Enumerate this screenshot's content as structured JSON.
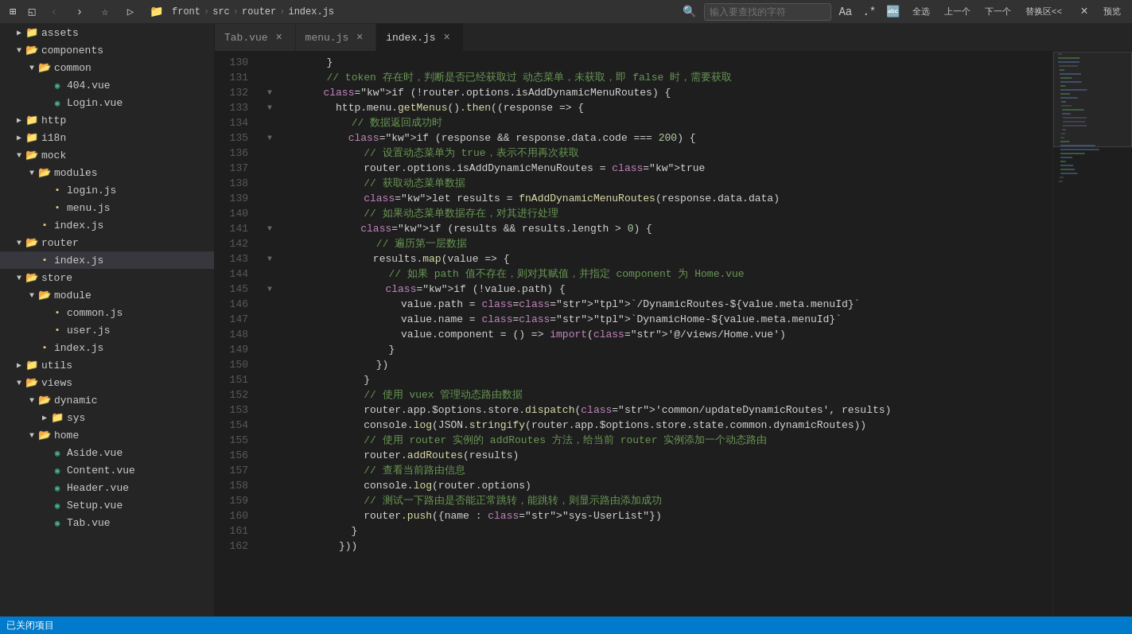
{
  "titlebar": {
    "icons": [
      "⊞",
      "◱"
    ],
    "nav_back": "‹",
    "nav_forward": "›",
    "nav_back_disabled": true,
    "nav_forward_disabled": false,
    "star_label": "☆",
    "play_label": "▷",
    "breadcrumb": [
      "front",
      "src",
      "router",
      "index.js"
    ],
    "search_placeholder": "输入要查找的字符",
    "btn_all": "全选",
    "btn_prev": "上一个",
    "btn_next": "下一个",
    "btn_replace": "替换区<<",
    "btn_close": "×",
    "btn_preview": "预览"
  },
  "tabs": [
    {
      "label": "Tab.vue",
      "active": false
    },
    {
      "label": "menu.js",
      "active": false
    },
    {
      "label": "index.js",
      "active": true
    }
  ],
  "sidebar": {
    "items": [
      {
        "type": "folder",
        "label": "assets",
        "depth": 1,
        "open": false
      },
      {
        "type": "folder",
        "label": "components",
        "depth": 1,
        "open": true
      },
      {
        "type": "folder",
        "label": "common",
        "depth": 2,
        "open": true
      },
      {
        "type": "file",
        "label": "404.vue",
        "depth": 3,
        "ext": "vue"
      },
      {
        "type": "file",
        "label": "Login.vue",
        "depth": 3,
        "ext": "vue"
      },
      {
        "type": "folder",
        "label": "http",
        "depth": 1,
        "open": false
      },
      {
        "type": "folder",
        "label": "i18n",
        "depth": 1,
        "open": false
      },
      {
        "type": "folder",
        "label": "mock",
        "depth": 1,
        "open": true
      },
      {
        "type": "folder",
        "label": "modules",
        "depth": 2,
        "open": true
      },
      {
        "type": "file",
        "label": "login.js",
        "depth": 3,
        "ext": "js"
      },
      {
        "type": "file",
        "label": "menu.js",
        "depth": 3,
        "ext": "js"
      },
      {
        "type": "file",
        "label": "index.js",
        "depth": 2,
        "ext": "js"
      },
      {
        "type": "folder",
        "label": "router",
        "depth": 1,
        "open": true,
        "active": true
      },
      {
        "type": "file",
        "label": "index.js",
        "depth": 2,
        "ext": "js",
        "active": true
      },
      {
        "type": "folder",
        "label": "store",
        "depth": 1,
        "open": true
      },
      {
        "type": "folder",
        "label": "module",
        "depth": 2,
        "open": true
      },
      {
        "type": "file",
        "label": "common.js",
        "depth": 3,
        "ext": "js"
      },
      {
        "type": "file",
        "label": "user.js",
        "depth": 3,
        "ext": "js"
      },
      {
        "type": "file",
        "label": "index.js",
        "depth": 2,
        "ext": "js"
      },
      {
        "type": "folder",
        "label": "utils",
        "depth": 1,
        "open": false
      },
      {
        "type": "folder",
        "label": "views",
        "depth": 1,
        "open": true
      },
      {
        "type": "folder",
        "label": "dynamic",
        "depth": 2,
        "open": true
      },
      {
        "type": "folder",
        "label": "sys",
        "depth": 3,
        "open": false
      },
      {
        "type": "folder",
        "label": "home",
        "depth": 2,
        "open": true
      },
      {
        "type": "file",
        "label": "Aside.vue",
        "depth": 3,
        "ext": "vue"
      },
      {
        "type": "file",
        "label": "Content.vue",
        "depth": 3,
        "ext": "vue"
      },
      {
        "type": "file",
        "label": "Header.vue",
        "depth": 3,
        "ext": "vue"
      },
      {
        "type": "file",
        "label": "Setup.vue",
        "depth": 3,
        "ext": "vue"
      },
      {
        "type": "file",
        "label": "Tab.vue",
        "depth": 3,
        "ext": "vue"
      }
    ]
  },
  "status_bar": {
    "text": "已关闭项目"
  },
  "code_lines": [
    {
      "num": 130,
      "content": "        }"
    },
    {
      "num": 131,
      "content": "        // token 存在时，判断是否已经获取过 动态菜单，未获取，即 false 时，需要获取"
    },
    {
      "num": 132,
      "content": "        if (!router.options.isAddDynamicMenuRoutes) {",
      "foldable": true
    },
    {
      "num": 133,
      "content": "          http.menu.getMenus().then((response => {",
      "foldable": true
    },
    {
      "num": 134,
      "content": "            // 数据返回成功时"
    },
    {
      "num": 135,
      "content": "            if (response && response.data.code === 200) {",
      "foldable": true
    },
    {
      "num": 136,
      "content": "              // 设置动态菜单为 true，表示不用再次获取"
    },
    {
      "num": 137,
      "content": "              router.options.isAddDynamicMenuRoutes = true"
    },
    {
      "num": 138,
      "content": "              // 获取动态菜单数据"
    },
    {
      "num": 139,
      "content": "              let results = fnAddDynamicMenuRoutes(response.data.data)"
    },
    {
      "num": 140,
      "content": "              // 如果动态菜单数据存在，对其进行处理"
    },
    {
      "num": 141,
      "content": "              if (results && results.length > 0) {",
      "foldable": true
    },
    {
      "num": 142,
      "content": "                // 遍历第一层数据"
    },
    {
      "num": 143,
      "content": "                results.map(value => {",
      "foldable": true
    },
    {
      "num": 144,
      "content": "                  // 如果 path 值不存在，则对其赋值，并指定 component 为 Home.vue"
    },
    {
      "num": 145,
      "content": "                  if (!value.path) {",
      "foldable": true
    },
    {
      "num": 146,
      "content": "                    value.path = `/DynamicRoutes-${value.meta.menuId}`"
    },
    {
      "num": 147,
      "content": "                    value.name = `DynamicHome-${value.meta.menuId}`"
    },
    {
      "num": 148,
      "content": "                    value.component = () => import('@/views/Home.vue')"
    },
    {
      "num": 149,
      "content": "                  }"
    },
    {
      "num": 150,
      "content": "                })"
    },
    {
      "num": 151,
      "content": "              }"
    },
    {
      "num": 152,
      "content": "              // 使用 vuex 管理动态路由数据"
    },
    {
      "num": 153,
      "content": "              router.app.$options.store.dispatch('common/updateDynamicRoutes', results)"
    },
    {
      "num": 154,
      "content": "              console.log(JSON.stringify(router.app.$options.store.state.common.dynamicRoutes))"
    },
    {
      "num": 155,
      "content": "              // 使用 router 实例的 addRoutes 方法，给当前 router 实例添加一个动态路由"
    },
    {
      "num": 156,
      "content": "              router.addRoutes(results)"
    },
    {
      "num": 157,
      "content": "              // 查看当前路由信息"
    },
    {
      "num": 158,
      "content": "              console.log(router.options)"
    },
    {
      "num": 159,
      "content": "              // 测试一下路由是否能正常跳转，能跳转，则显示路由添加成功"
    },
    {
      "num": 160,
      "content": "              router.push({name : \"sys-UserList\"})"
    },
    {
      "num": 161,
      "content": "            }"
    },
    {
      "num": 162,
      "content": "          }))"
    }
  ]
}
